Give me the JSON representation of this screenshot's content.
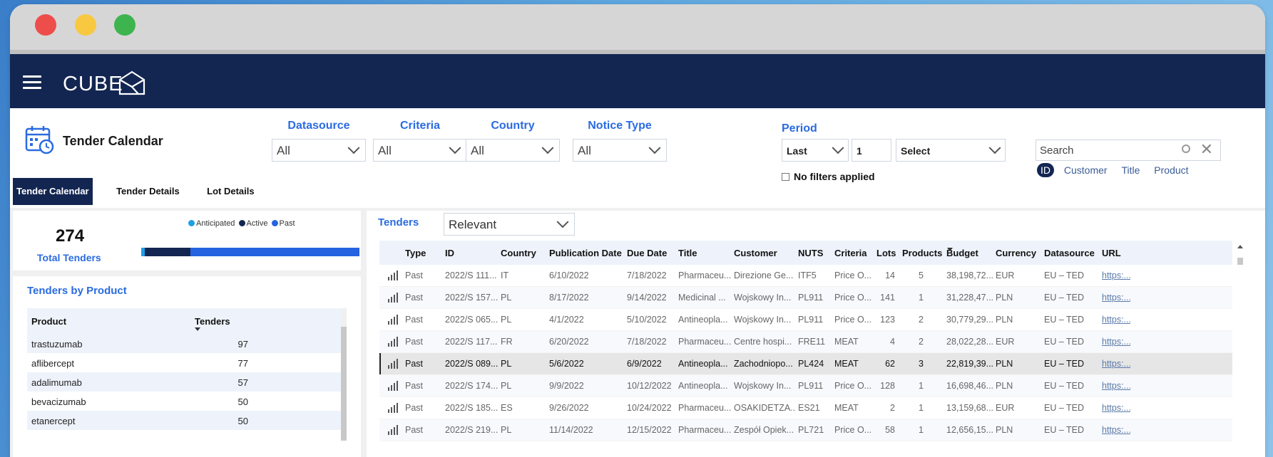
{
  "app": {
    "logo_text": "CUBE"
  },
  "page": {
    "title": "Tender Calendar"
  },
  "filters": [
    {
      "label": "Datasource",
      "value": "All"
    },
    {
      "label": "Criteria",
      "value": "All"
    },
    {
      "label": "Country",
      "value": "All"
    },
    {
      "label": "Notice Type",
      "value": "All"
    }
  ],
  "period": {
    "label": "Period",
    "mode": "Last",
    "count": "1",
    "unit": "Select",
    "status": "No filters applied"
  },
  "search": {
    "placeholder": "Search",
    "chips": [
      "ID",
      "Customer",
      "Title",
      "Product"
    ]
  },
  "tabs": [
    "Tender Calendar",
    "Tender Details",
    "Lot Details"
  ],
  "kpi": {
    "total": "274",
    "label": "Total Tenders",
    "legend": [
      "Anticipated",
      "Active",
      "Past"
    ],
    "colors": {
      "anticipated": "#1ca0e8",
      "active": "#132652",
      "past": "#2563e0"
    },
    "split": {
      "anticipated": 0.015,
      "active": 0.21,
      "past": 0.775
    }
  },
  "products": {
    "title": "Tenders by Product",
    "headers": [
      "Product",
      "Tenders"
    ],
    "rows": [
      [
        "trastuzumab",
        "97"
      ],
      [
        "aflibercept",
        "77"
      ],
      [
        "adalimumab",
        "57"
      ],
      [
        "bevacizumab",
        "50"
      ],
      [
        "etanercept",
        "50"
      ]
    ]
  },
  "tenders": {
    "title": "Tenders",
    "view": "Relevant",
    "headers": [
      "Type",
      "ID",
      "Country",
      "Publication Date",
      "Due Date",
      "Title",
      "Customer",
      "NUTS",
      "Criteria",
      "Lots",
      "Products",
      "Budget",
      "Currency",
      "Datasource",
      "URL"
    ],
    "rows": [
      [
        "Past",
        "2022/S 111...",
        "IT",
        "6/10/2022",
        "7/18/2022",
        "Pharmaceu...",
        "Direzione Ge...",
        "ITF5",
        "Price O...",
        "14",
        "5",
        "38,198,72...",
        "EUR",
        "EU – TED",
        "https:..."
      ],
      [
        "Past",
        "2022/S 157...",
        "PL",
        "8/17/2022",
        "9/14/2022",
        "Medicinal ...",
        "Wojskowy In...",
        "PL911",
        "Price O...",
        "141",
        "1",
        "31,228,47...",
        "PLN",
        "EU – TED",
        "https:..."
      ],
      [
        "Past",
        "2022/S 065...",
        "PL",
        "4/1/2022",
        "5/10/2022",
        "Antineopla...",
        "Wojskowy In...",
        "PL911",
        "Price O...",
        "123",
        "2",
        "30,779,29...",
        "PLN",
        "EU – TED",
        "https:..."
      ],
      [
        "Past",
        "2022/S 117...",
        "FR",
        "6/20/2022",
        "7/18/2022",
        "Pharmaceu...",
        "Centre hospi...",
        "FRE11",
        "MEAT",
        "4",
        "2",
        "28,022,28...",
        "EUR",
        "EU – TED",
        "https:..."
      ],
      [
        "Past",
        "2022/S 089...",
        "PL",
        "5/6/2022",
        "6/9/2022",
        "Antineopla...",
        "Zachodniopo...",
        "PL424",
        "MEAT",
        "62",
        "3",
        "22,819,39...",
        "PLN",
        "EU – TED",
        "https:..."
      ],
      [
        "Past",
        "2022/S 174...",
        "PL",
        "9/9/2022",
        "10/12/2022",
        "Antineopla...",
        "Wojskowy In...",
        "PL911",
        "Price O...",
        "128",
        "1",
        "16,698,46...",
        "PLN",
        "EU – TED",
        "https:..."
      ],
      [
        "Past",
        "2022/S 185...",
        "ES",
        "9/26/2022",
        "10/24/2022",
        "Pharmaceu...",
        "OSAKIDETZA...",
        "ES21",
        "MEAT",
        "2",
        "1",
        "13,159,68...",
        "EUR",
        "EU – TED",
        "https:..."
      ],
      [
        "Past",
        "2022/S 219...",
        "PL",
        "11/14/2022",
        "12/15/2022",
        "Pharmaceu...",
        "Zespół Opiek...",
        "PL721",
        "Price O...",
        "58",
        "1",
        "12,656,15...",
        "PLN",
        "EU – TED",
        "https:..."
      ]
    ]
  }
}
